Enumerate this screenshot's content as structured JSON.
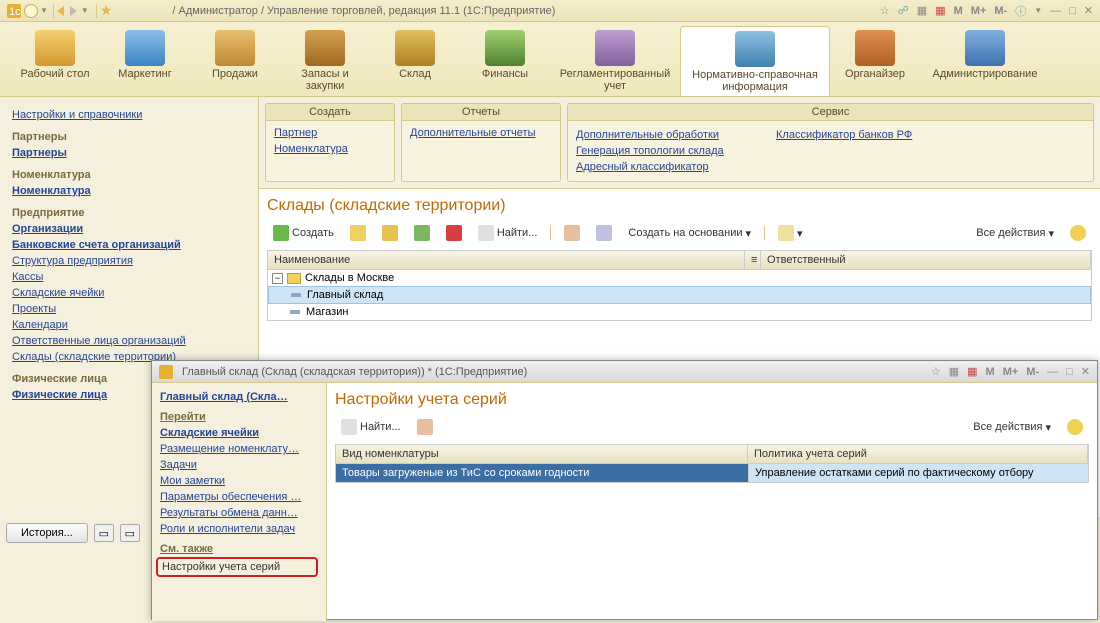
{
  "titlebar": {
    "title": " / Администратор / Управление торговлей, редакция 11.1   (1С:Предприятие)",
    "m": "M",
    "mplus": "M+",
    "mminus": "M-"
  },
  "sections": {
    "desk": "Рабочий стол",
    "mkt": "Маркетинг",
    "sales": "Продажи",
    "stock": "Запасы и закупки",
    "ware": "Склад",
    "fin": "Финансы",
    "reg": "Регламентированный учет",
    "ref": "Нормативно-справочная информация",
    "org": "Органайзер",
    "adm": "Администрирование"
  },
  "nav": {
    "spr": "Настройки и справочники",
    "partners_h": "Партнеры",
    "partners": "Партнеры",
    "nom_h": "Номенклатура",
    "nom": "Номенклатура",
    "ent_h": "Предприятие",
    "org": "Организации",
    "bank": "Банковские счета организаций",
    "struct": "Структура предприятия",
    "kassy": "Кассы",
    "cells": "Складские ячейки",
    "proj": "Проекты",
    "cal": "Календари",
    "resp": "Ответственные лица организаций",
    "wh": "Склады (складские территории)",
    "phys_h": "Физические лица",
    "phys": "Физические лица"
  },
  "actions": {
    "create_h": "Создать",
    "partner": "Партнер",
    "nomen": "Номенклатура",
    "reports_h": "Отчеты",
    "extrarep": "Дополнительные отчеты",
    "service_h": "Сервис",
    "extproc": "Дополнительные обработки",
    "gentopo": "Генерация топологии склада",
    "addrclass": "Адресный классификатор",
    "bankclass": "Классификатор банков РФ"
  },
  "main": {
    "title": "Склады (складские территории)",
    "create": "Создать",
    "find": "Найти...",
    "createby": "Создать на основании",
    "allactions": "Все действия",
    "col1": "Наименование",
    "col2": "Ответственный",
    "root": "Склады в Москве",
    "row1": "Главный склад",
    "row2": "Магазин"
  },
  "bottom": {
    "history": "История..."
  },
  "win2": {
    "title": "Главный склад (Склад (складская территория)) *  (1С:Предприятие)",
    "m": "M",
    "mplus": "M+",
    "mminus": "M-",
    "nav": {
      "hd": "Главный склад (Скла…",
      "go": "Перейти",
      "cells": "Складские ячейки",
      "place": "Размещение номенклату…",
      "tasks": "Задачи",
      "notes": "Мои заметки",
      "params": "Параметры обеспечения …",
      "exch": "Результаты обмена данн…",
      "roles": "Роли и исполнители задач",
      "see": "См. также",
      "settings": "Настройки учета серий"
    },
    "main": {
      "title": "Настройки учета серий",
      "find": "Найти...",
      "allactions": "Все действия",
      "col1": "Вид номенклатуры",
      "col2": "Политика учета серий",
      "r1c1": "Товары загруженые из ТиС со сроками годности",
      "r1c2": "Управление остатками серий по фактическому отбору"
    }
  }
}
